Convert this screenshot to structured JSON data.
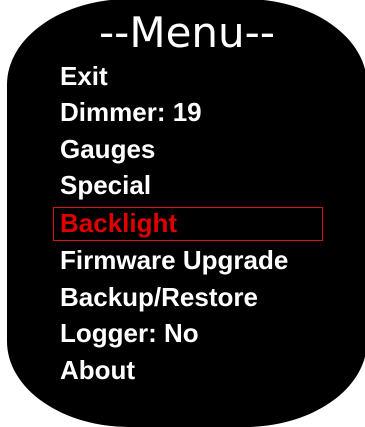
{
  "menu": {
    "title": "--Menu--",
    "items": [
      {
        "label": "Exit"
      },
      {
        "label": "Dimmer: 19"
      },
      {
        "label": "Gauges"
      },
      {
        "label": "Special"
      },
      {
        "label": "Backlight"
      },
      {
        "label": "Firmware Upgrade"
      },
      {
        "label": "Backup/Restore"
      },
      {
        "label": "Logger: No"
      },
      {
        "label": "About"
      }
    ],
    "selected_label": "Backlight"
  },
  "colors": {
    "background": "#000000",
    "text": "#ffffff",
    "selected_text": "#e00000",
    "selected_border": "#d21414"
  }
}
